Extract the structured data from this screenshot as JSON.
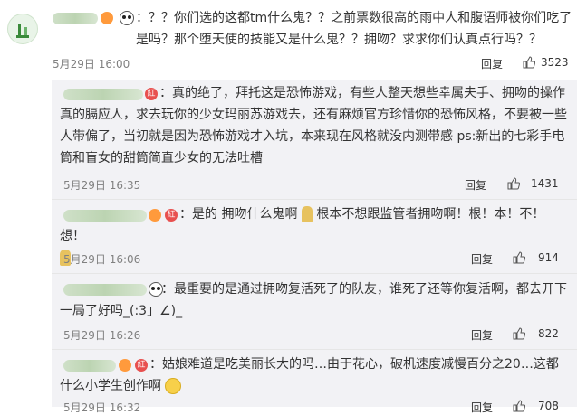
{
  "comments": [
    {
      "text": "：？？你们选的这都tm什么鬼？？之前票数很高的雨中人和腹语师被你们吃了是吗？那个堕天使的技能又是什么鬼？？拥吻？求求你们认真点行吗？？",
      "date": "5月29日 16:00",
      "reply_label": "回复",
      "likes": "3523"
    },
    {
      "text": "：真的绝了，拜托这是恐怖游戏，有些人整天想些幸属夫手、拥吻的操作真的膈应人，求去玩你的少女玛丽苏游戏去，还有麻烦官方珍惜你的恐怖风格，不要被一些人带偏了，当初就是因为恐怖游戏才入坑，本来现在风格就没内测带感 ps:新出的七彩手电筒和盲女的甜筒简直少女的无法吐槽",
      "date": "5月29日 16:35",
      "reply_label": "回复",
      "likes": "1431"
    },
    {
      "text_a": "：是的 拥吻什么鬼啊",
      "text_b": "根本不想跟监管者拥吻啊！根！本！不！想！",
      "date": "5月29日 16:06",
      "reply_label": "回复",
      "likes": "914"
    },
    {
      "text": "：最重要的是通过拥吻复活死了的队友，谁死了还等你复活啊，都去开下一局了好吗_(:3」∠)_",
      "date": "5月29日 16:26",
      "reply_label": "回复",
      "likes": "822"
    },
    {
      "text": "：姑娘难道是吃美丽长大的吗…由于花心，破机速度减慢百分之20…这都什么小学生创作啊",
      "date": "5月29日 16:32",
      "reply_label": "回复",
      "likes": "708"
    }
  ],
  "badges": {
    "level": "紅"
  },
  "colors": {
    "sub_bg": "#f2f2f5",
    "meta": "#808080",
    "name_blur": "#cfe0c8"
  }
}
